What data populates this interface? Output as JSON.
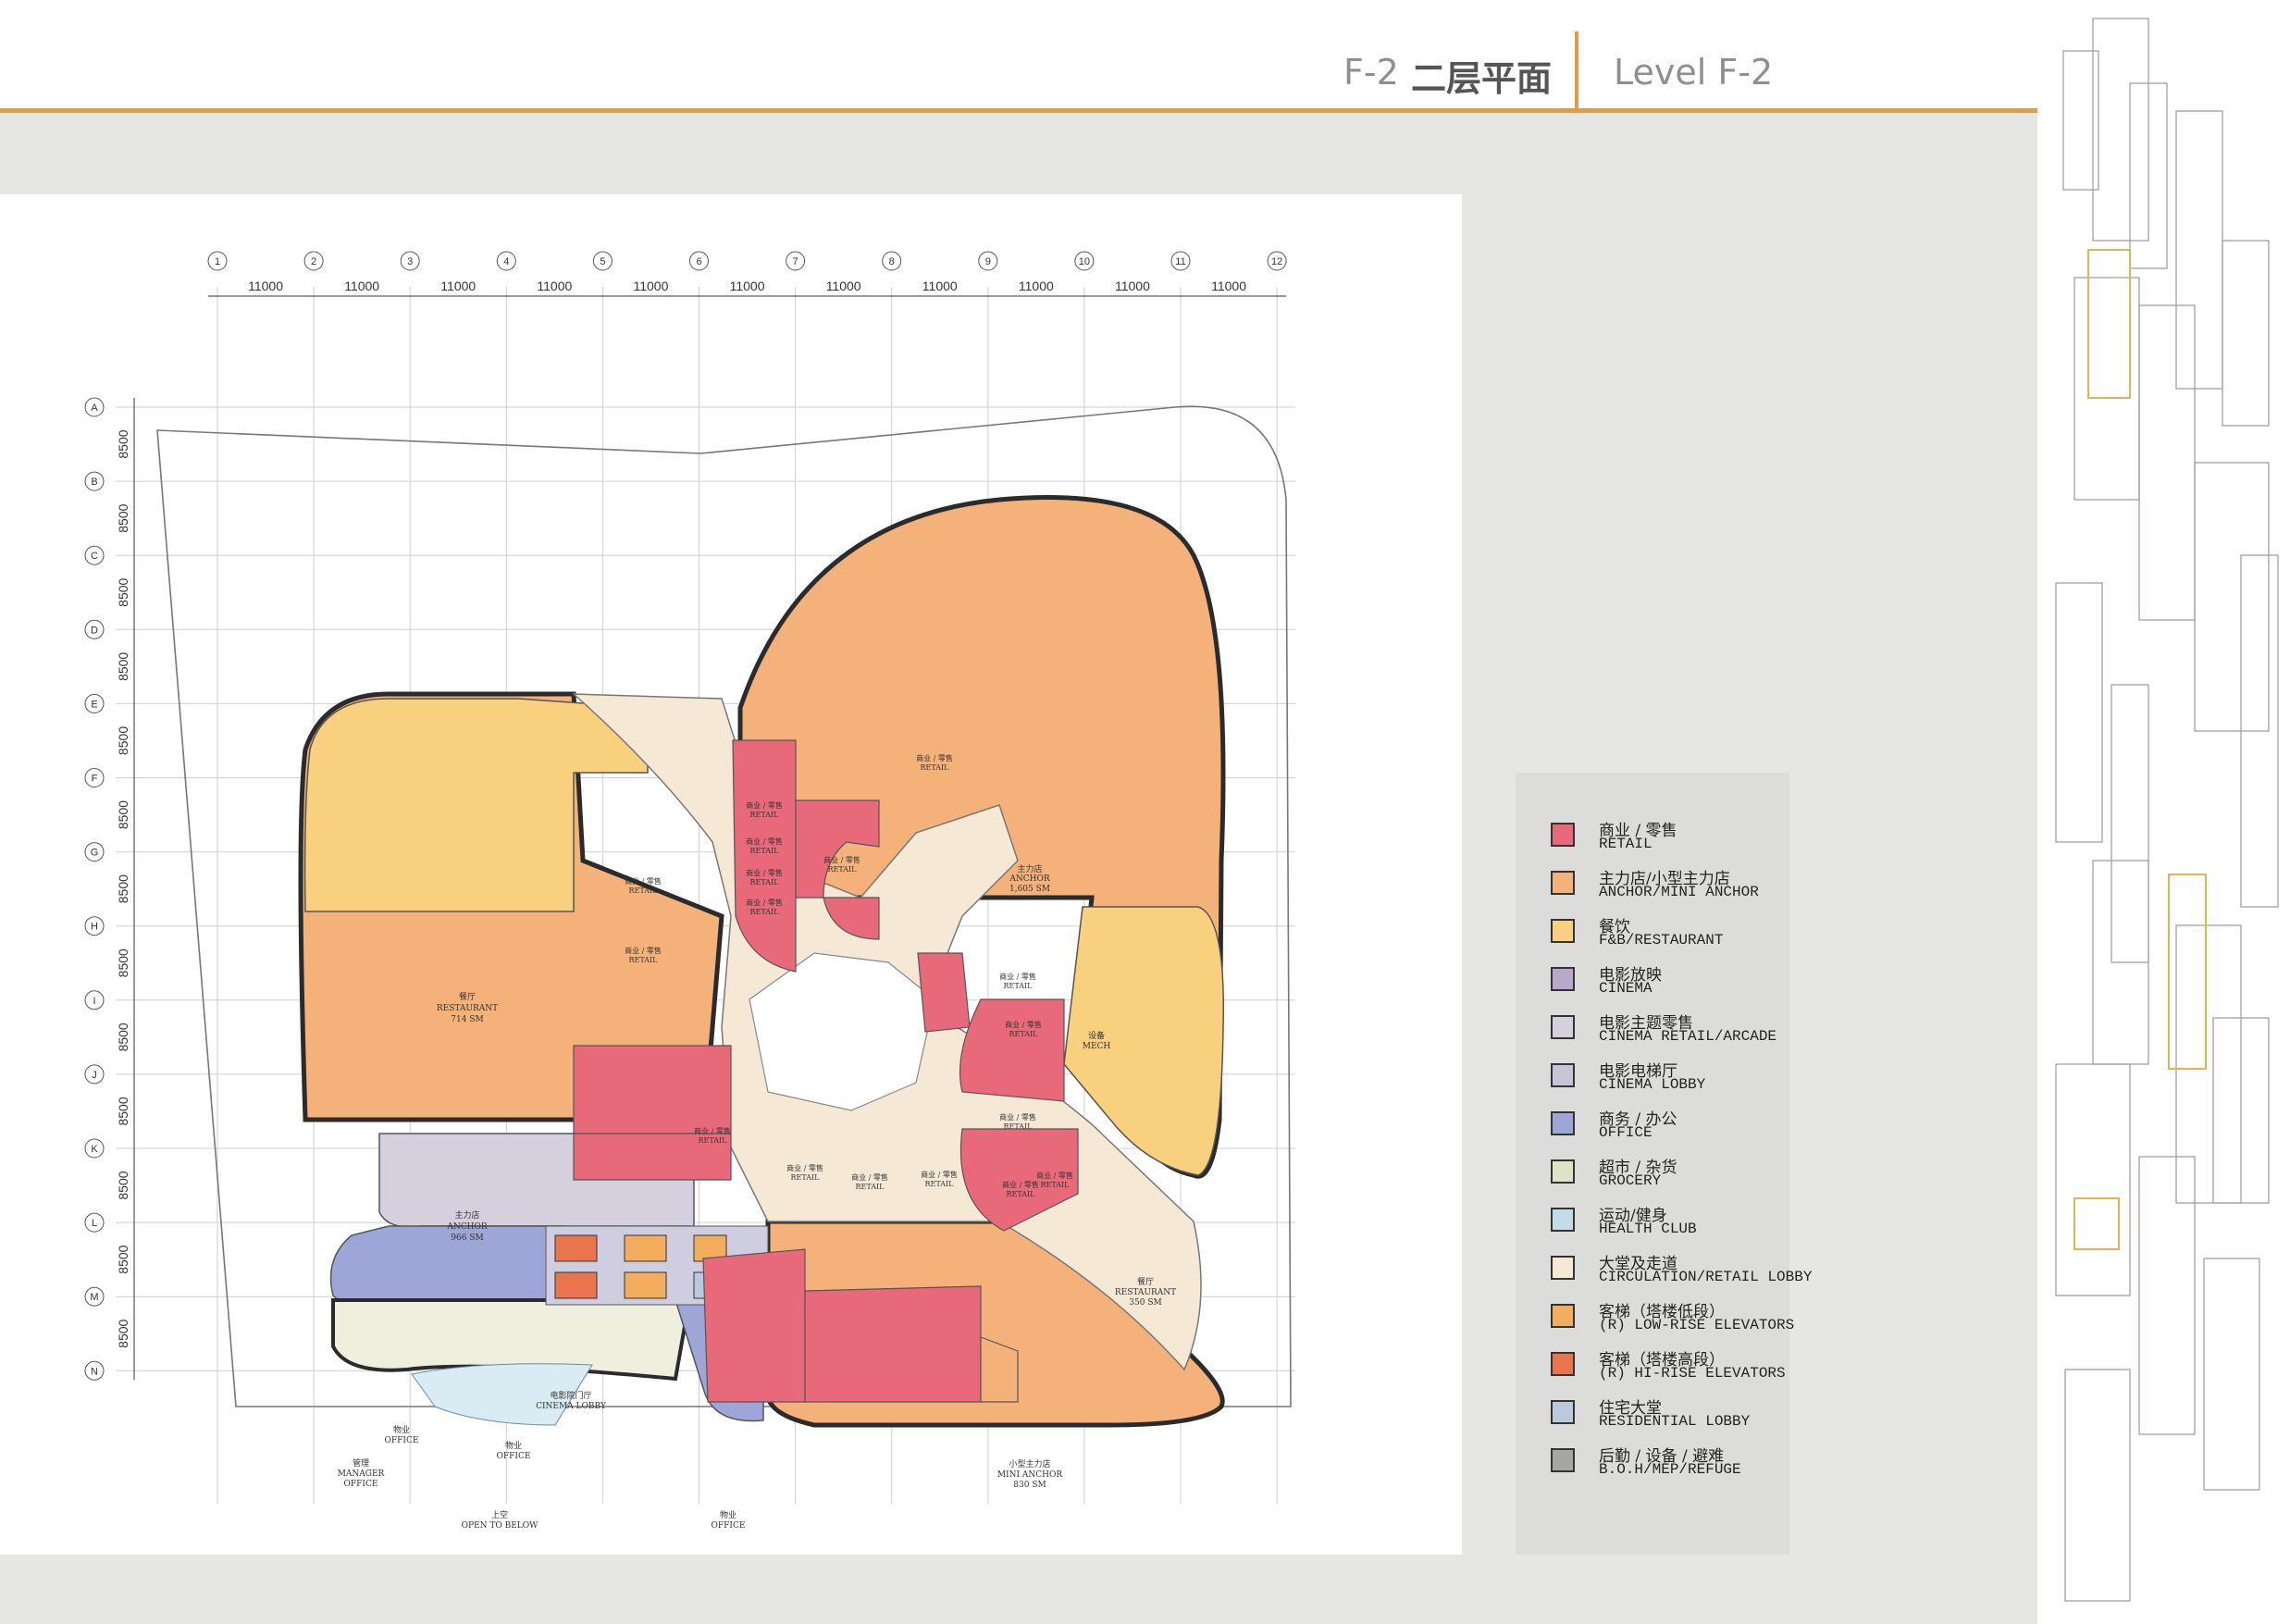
{
  "header": {
    "code": "F-2",
    "title_cn": "二层平面",
    "title_en": "Level F-2"
  },
  "grid": {
    "columns": [
      "1",
      "2",
      "3",
      "4",
      "5",
      "6",
      "7",
      "8",
      "9",
      "10",
      "11",
      "12"
    ],
    "column_spacing_label": "11000",
    "rows": [
      "A",
      "B",
      "C",
      "D",
      "E",
      "F",
      "G",
      "H",
      "I",
      "J",
      "K",
      "L",
      "M",
      "N"
    ],
    "row_spacing_label": "8500"
  },
  "rooms": {
    "anchor_top": {
      "cn": "主力店",
      "en": "ANCHOR",
      "area": "1,605 SM"
    },
    "restaurant_left": {
      "cn": "餐厅",
      "en": "RESTAURANT",
      "area": "714 SM"
    },
    "anchor_left": {
      "cn": "主力店",
      "en": "ANCHOR",
      "area": "966 SM"
    },
    "restaurant_right": {
      "cn": "餐厅",
      "en": "RESTAURANT",
      "area": "350 SM"
    },
    "mini_anchor": {
      "cn": "小型主力店",
      "en": "MINI ANCHOR",
      "area": "830 SM"
    },
    "retail_cn": "商业 / 零售",
    "retail_en": "RETAIL",
    "cinema_lobby": {
      "cn": "电影院门厅",
      "en": "CINEMA LOBBY"
    },
    "office": {
      "cn": "物业",
      "en": "OFFICE"
    },
    "manager": {
      "cn": "管理",
      "en": "MANAGER",
      "sub": "OFFICE"
    },
    "open_to_below": {
      "cn": "上空",
      "en": "OPEN TO BELOW"
    },
    "mep": {
      "cn": "设备",
      "en": "MECH"
    }
  },
  "legend": [
    {
      "cn": "商业 / 零售",
      "en": "RETAIL",
      "color": "#E86A7A"
    },
    {
      "cn": "主力店/小型主力店",
      "en": "ANCHOR/MINI ANCHOR",
      "color": "#F4B27A"
    },
    {
      "cn": "餐饮",
      "en": "F&B/RESTAURANT",
      "color": "#F8D07E"
    },
    {
      "cn": "电影放映",
      "en": "CINEMA",
      "color": "#B8A9CA"
    },
    {
      "cn": "电影主题零售",
      "en": "CINEMA RETAIL/ARCADE",
      "color": "#D5D0DE"
    },
    {
      "cn": "电影电梯厅",
      "en": "CINEMA LOBBY",
      "color": "#C9C3D6"
    },
    {
      "cn": "商务 / 办公",
      "en": "OFFICE",
      "color": "#9DA6D6"
    },
    {
      "cn": "超市 / 杂货",
      "en": "GROCERY",
      "color": "#DDE3C4"
    },
    {
      "cn": "运动/健身",
      "en": "HEALTH CLUB",
      "color": "#C2DCEA"
    },
    {
      "cn": "大堂及走道",
      "en": "CIRCULATION/RETAIL LOBBY",
      "color": "#F5E9D5"
    },
    {
      "cn": "客梯（塔楼低段）",
      "en": "(R) LOW-RISE ELEVATORS",
      "color": "#F2AE5C"
    },
    {
      "cn": "客梯（塔楼高段）",
      "en": "(R) HI-RISE ELEVATORS",
      "color": "#E8754D"
    },
    {
      "cn": "住宅大堂",
      "en": "RESIDENTIAL LOBBY",
      "color": "#BCC9DC"
    },
    {
      "cn": "后勤 / 设备 / 避难",
      "en": "B.O.H/MEP/REFUGE",
      "color": "#A6A6A3"
    }
  ],
  "colors": {
    "accent": "#E39B45",
    "retail": "#E86A7A",
    "anchor": "#F4B27A",
    "restaurant": "#F8D07E",
    "circulation": "#F5E9D5",
    "office": "#9DA6D6",
    "cinema_lobby": "#D5D0DE",
    "boh": "#A6A6A3",
    "open_below": "#EEF0DD"
  }
}
